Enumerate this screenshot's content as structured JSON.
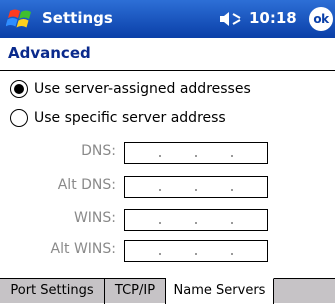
{
  "titlebar": {
    "title": "Settings",
    "time": "10:18",
    "ok_label": "ok",
    "start_icon": "windows-flag-icon",
    "volume_icon": "speaker-icon"
  },
  "section": {
    "title": "Advanced"
  },
  "options": [
    {
      "label": "Use server-assigned addresses",
      "selected": true
    },
    {
      "label": "Use specific server address",
      "selected": false
    }
  ],
  "fields": [
    {
      "label": "DNS:",
      "value": "",
      "enabled": false
    },
    {
      "label": "Alt DNS:",
      "value": "",
      "enabled": false
    },
    {
      "label": "WINS:",
      "value": "",
      "enabled": false
    },
    {
      "label": "Alt WINS:",
      "value": "",
      "enabled": false
    }
  ],
  "tabs": [
    {
      "label": "Port Settings",
      "active": false
    },
    {
      "label": "TCP/IP",
      "active": false
    },
    {
      "label": "Name Servers",
      "active": true
    }
  ],
  "colors": {
    "titlebar": "#0a3fa8",
    "section_title": "#0a2a8c",
    "disabled_label": "#8a8a8a",
    "tabbar": "#c6c3c6"
  }
}
